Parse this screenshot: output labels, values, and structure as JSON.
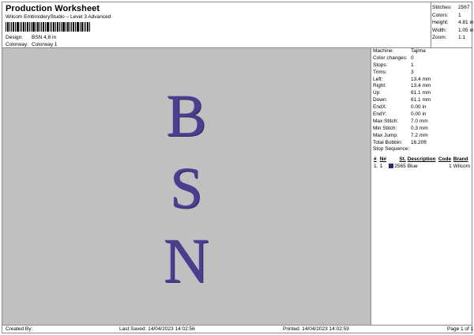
{
  "header": {
    "title": "Production Worksheet",
    "subtitle": "Wilcom EmbroideryStudio – Level 3 Advanced"
  },
  "meta": {
    "design_label": "Design:",
    "design_value": "BSN 4,8 in",
    "colorway_label": "Colorway:",
    "colorway_value": "Colorway 1"
  },
  "stats": [
    {
      "label": "Stitches:",
      "value": "2567"
    },
    {
      "label": "Colors:",
      "value": "1"
    },
    {
      "label": "Height:",
      "value": "4.81 in"
    },
    {
      "label": "Width:",
      "value": "1.05 in"
    },
    {
      "label": "Zoom:",
      "value": "1:1"
    }
  ],
  "design_preview": {
    "letters": [
      "B",
      "S",
      "N"
    ],
    "thread_color": "#4a3f8e",
    "background_color": "#c0c0c0"
  },
  "info": [
    {
      "label": "Machine:",
      "value": "Tajima"
    },
    {
      "label": "Color changes:",
      "value": "0"
    },
    {
      "label": "Stops:",
      "value": "1"
    },
    {
      "label": "Trims:",
      "value": "3"
    },
    {
      "label": "Left:",
      "value": "13.4 mm"
    },
    {
      "label": "Right:",
      "value": "13.4 mm"
    },
    {
      "label": "Up:",
      "value": "61.1 mm"
    },
    {
      "label": "Down:",
      "value": "61.1 mm"
    },
    {
      "label": "EndX:",
      "value": "0.00 in"
    },
    {
      "label": "EndY:",
      "value": "0.00 in"
    },
    {
      "label": "Max Stitch:",
      "value": "7.0 mm"
    },
    {
      "label": "Min Stitch:",
      "value": "0.3 mm"
    },
    {
      "label": "Max Jump:",
      "value": "7.2 mm"
    },
    {
      "label": "Total Bobbin:",
      "value": "16.20ft"
    }
  ],
  "stop_sequence": {
    "label": "Stop Sequence:",
    "columns": [
      "#",
      "N#",
      "St.",
      "Description",
      "Code",
      "Brand"
    ],
    "rows": [
      {
        "index": "1.",
        "n": "1",
        "swatch_color": "#2f2a6b",
        "stitches": "2565",
        "description": "Blue",
        "code": "1",
        "brand": "Wilcom"
      }
    ]
  },
  "footer": {
    "created_by": "Created By:",
    "last_saved": "Last Saved: 14/04/2023 14:02:56",
    "printed": "Printed: 14/04/2023 14:02:59",
    "page": "Page 1 of 1"
  }
}
